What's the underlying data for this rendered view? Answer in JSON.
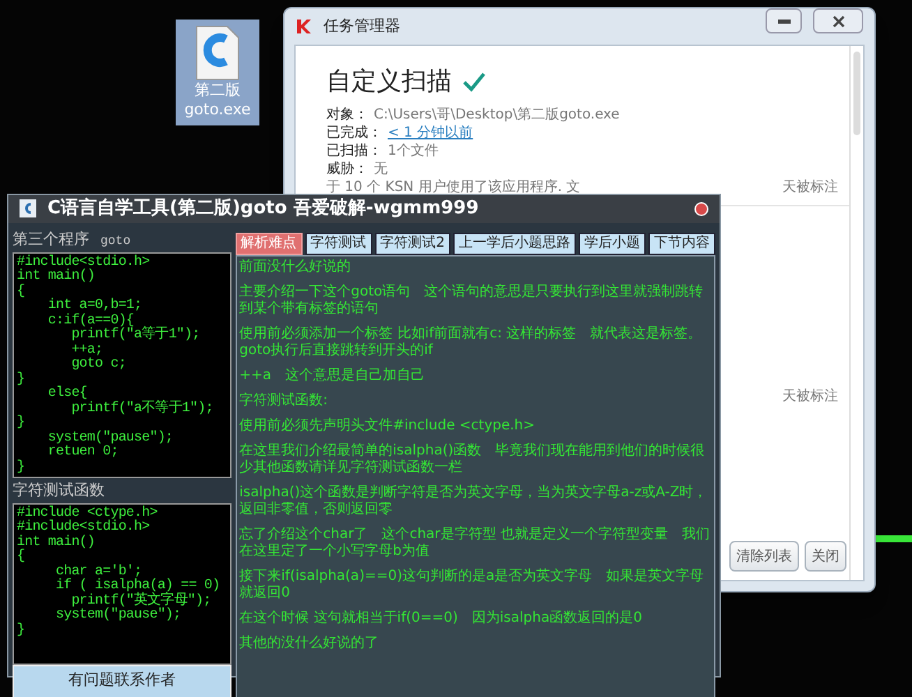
{
  "desktop_icon": {
    "label_lines": [
      "第二版",
      "goto.exe"
    ],
    "selected": true
  },
  "scan_window": {
    "title": "任务管理器",
    "heading": "自定义扫描",
    "details": [
      {
        "label": "对象：",
        "value": "C:\\Users\\哥\\Desktop\\第二版goto.exe",
        "kind": "text"
      },
      {
        "label": "已完成：",
        "value": "< 1 分钟以前",
        "kind": "link"
      },
      {
        "label": "已扫描：",
        "value": "1个文件",
        "kind": "text"
      },
      {
        "label": "威胁：",
        "value": "无",
        "kind": "text"
      }
    ],
    "reputation_fragment": "于 10 个 KSN 用户使用了该应用程序. 文",
    "marked_notes": [
      "天被标注",
      "天被标注"
    ],
    "buttons": [
      "清除列表",
      "关闭"
    ]
  },
  "tool_window": {
    "title": "C语言自学工具(第二版)goto 吾爱破解-wgmm999",
    "program_sections": [
      {
        "title": "第三个程序",
        "tag": "goto",
        "code": [
          "#include<stdio.h>",
          "int main()",
          "{",
          "    int a=0,b=1;",
          "    c:if(a==0){",
          "       printf(\"a等于1\");",
          "       ++a;",
          "       goto c;",
          "}",
          "    else{",
          "       printf(\"a不等于1\");",
          "}",
          "    system(\"pause\");",
          "    retuen 0;",
          "}"
        ]
      },
      {
        "title": "字符测试函数",
        "code": [
          "#include <ctype.h>",
          "#include<stdio.h>",
          "int main()",
          "{",
          "     char a='b';",
          "     if ( isalpha(a) == 0)",
          "       printf(\"英文字母\");",
          "     system(\"pause\");",
          "}"
        ]
      }
    ],
    "contact_button": "有问题联系作者",
    "tabs": [
      {
        "label": "解析难点",
        "selected": true
      },
      {
        "label": "字符测试",
        "selected": false
      },
      {
        "label": "字符测试2",
        "selected": false
      },
      {
        "label": "上一学后小题思路",
        "selected": false
      },
      {
        "label": "学后小题",
        "selected": false
      },
      {
        "label": "下节内容",
        "selected": false
      }
    ],
    "paragraphs": [
      "前面没什么好说的",
      "主要介绍一下这个goto语句　这个语句的意思是只要执行到这里就强制跳转到某个带有标签的语句",
      "使用前必须添加一个标签 比如if前面就有c: 这样的标签　就代表这是标签。goto执行后直接跳转到开头的if",
      "++a　这个意思是自己加自己",
      "字符测试函数:",
      "使用前必须先声明头文件#include <ctype.h>",
      "在这里我们介绍最简单的isalpha()函数　毕竟我们现在能用到他们的时候很少其他函数请详见字符测试函数一栏",
      "isalpha()这个函数是判断字符是否为英文字母，当为英文字母a-z或A-Z时，返回非零值，否则返回零",
      "忘了介绍这个char了　这个char是字符型 也就是定义一个字符型变量　我们在这里定了一个小写字母b为值",
      "接下来if(isalpha(a)==0)这句判断的是a是否为英文字母　如果是英文字母就返回0",
      "在这个时候 这句就相当于if(0==0)　因为isalpha函数返回的是0",
      "其他的没什么好说的了"
    ]
  }
}
